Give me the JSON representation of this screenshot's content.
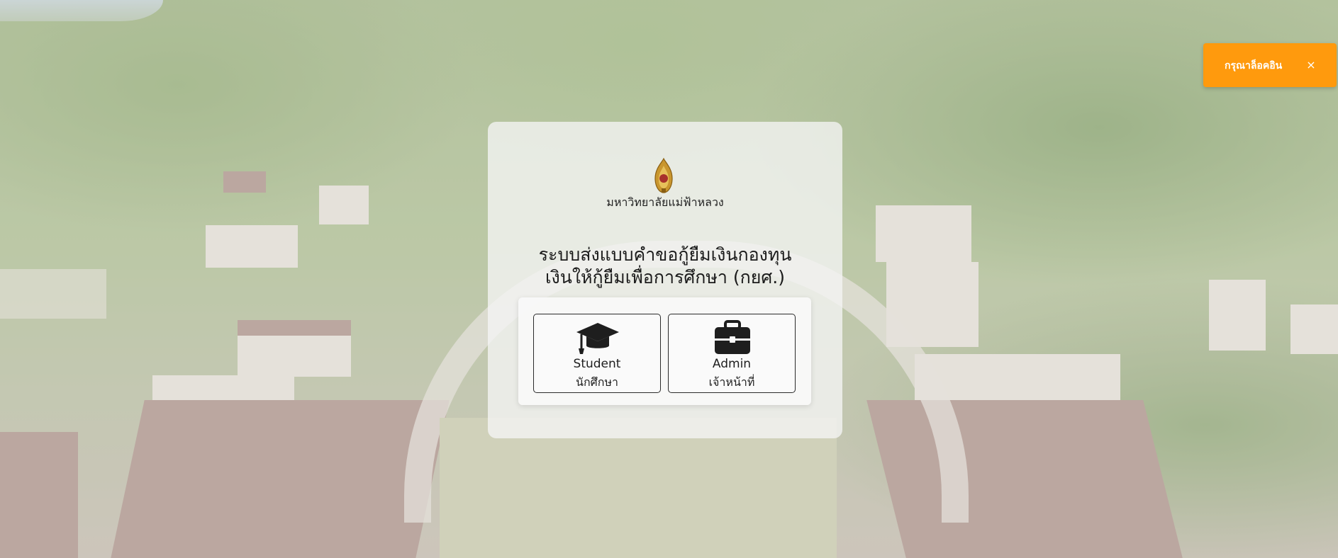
{
  "university": {
    "name": "มหาวิทยาลัยแม่ฟ้าหลวง"
  },
  "system": {
    "title_line1": "ระบบส่งแบบคำขอกู้ยืมเงินกองทุน",
    "title_line2": "เงินให้กู้ยืมเพื่อการศึกษา (กยศ.)"
  },
  "roles": [
    {
      "label_en": "Student",
      "label_th": "นักศึกษา",
      "icon": "graduation-cap-icon"
    },
    {
      "label_en": "Admin",
      "label_th": "เจ้าหน้าที่",
      "icon": "briefcase-icon"
    }
  ],
  "toast": {
    "message": "กรุณาล็อคอิน",
    "close_symbol": "×",
    "color": "#ff9a0d"
  }
}
